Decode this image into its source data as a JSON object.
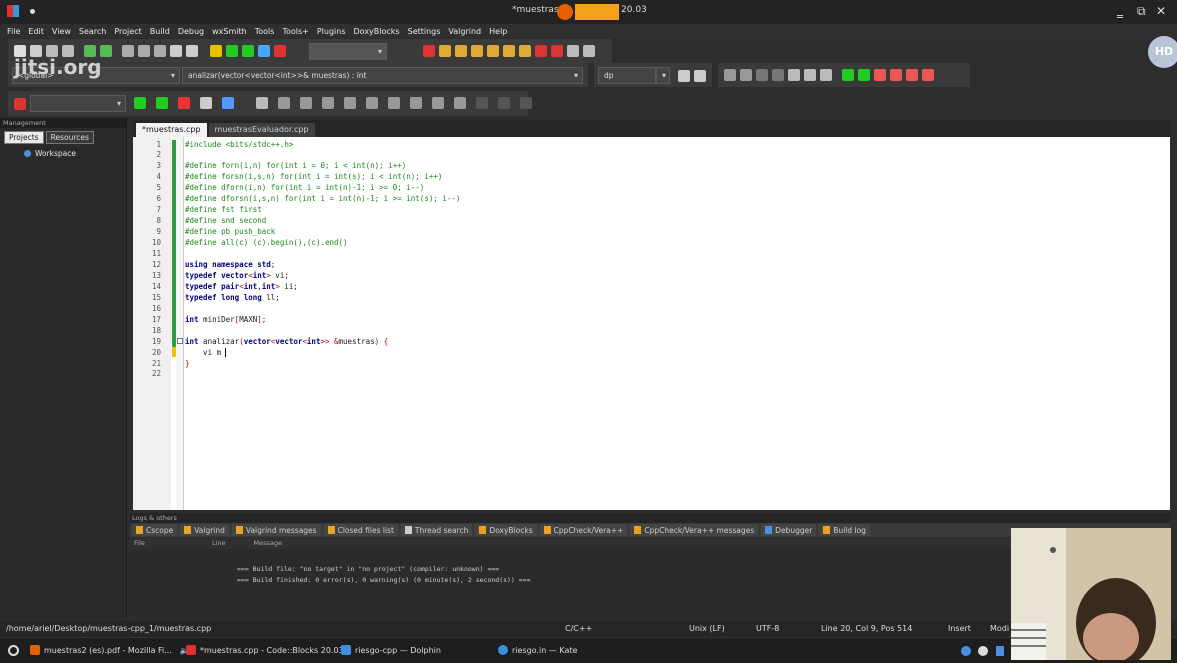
{
  "window": {
    "title_left": "*muestras.c",
    "title_right": "20.03"
  },
  "menu": [
    "File",
    "Edit",
    "View",
    "Search",
    "Project",
    "Build",
    "Debug",
    "wxSmith",
    "Tools",
    "Tools+",
    "Plugins",
    "DoxyBlocks",
    "Settings",
    "Valgrind",
    "Help"
  ],
  "toolbar": {
    "scope_combo": "<global>",
    "function_combo": "analizar(vector<vector<int>>& muestras) : int",
    "search_combo": "dp"
  },
  "overlay": {
    "jitsi_brand": "jitsi.org",
    "hd_badge": "HD"
  },
  "sidebar": {
    "header": "Management",
    "tabs": [
      "Projects",
      "Resources"
    ],
    "active_tab": "Projects",
    "tree_root": "Workspace"
  },
  "editor": {
    "tabs": [
      "*muestras.cpp",
      "muestrasEvaluador.cpp"
    ],
    "active_tab": "*muestras.cpp",
    "lines": [
      {
        "n": "1",
        "segs": [
          [
            "pp",
            "#include <bits/stdc++.h>"
          ]
        ]
      },
      {
        "n": "2",
        "segs": []
      },
      {
        "n": "3",
        "segs": [
          [
            "pp",
            "#define forn(i,n) for(int i = 0; i < int(n); i++)"
          ]
        ]
      },
      {
        "n": "4",
        "segs": [
          [
            "pp",
            "#define forsn(i,s,n) for(int i = int(s); i < int(n); i++)"
          ]
        ]
      },
      {
        "n": "5",
        "segs": [
          [
            "pp",
            "#define dforn(i,n) for(int i = int(n)-1; i >= 0; i--)"
          ]
        ]
      },
      {
        "n": "6",
        "segs": [
          [
            "pp",
            "#define dforsn(i,s,n) for(int i = int(n)-1; i >= int(s); i--)"
          ]
        ]
      },
      {
        "n": "7",
        "segs": [
          [
            "pp",
            "#define fst first"
          ]
        ]
      },
      {
        "n": "8",
        "segs": [
          [
            "pp",
            "#define snd second"
          ]
        ]
      },
      {
        "n": "9",
        "segs": [
          [
            "pp",
            "#define pb push_back"
          ]
        ]
      },
      {
        "n": "10",
        "segs": [
          [
            "pp",
            "#define all(c) (c).begin(),(c).end()"
          ]
        ]
      },
      {
        "n": "11",
        "segs": []
      },
      {
        "n": "12",
        "segs": [
          [
            "kw",
            "using namespace std"
          ],
          [
            "pl",
            ";"
          ]
        ]
      },
      {
        "n": "13",
        "segs": [
          [
            "kw",
            "typedef vector"
          ],
          [
            "op",
            "<"
          ],
          [
            "kw",
            "int"
          ],
          [
            "op",
            ">"
          ],
          [
            "pl",
            " vi;"
          ]
        ]
      },
      {
        "n": "14",
        "segs": [
          [
            "kw",
            "typedef pair"
          ],
          [
            "op",
            "<"
          ],
          [
            "kw",
            "int"
          ],
          [
            "pl",
            ","
          ],
          [
            "kw",
            "int"
          ],
          [
            "op",
            ">"
          ],
          [
            "pl",
            " ii;"
          ]
        ]
      },
      {
        "n": "15",
        "segs": [
          [
            "kw",
            "typedef long long"
          ],
          [
            "pl",
            " ll;"
          ]
        ]
      },
      {
        "n": "16",
        "segs": []
      },
      {
        "n": "17",
        "segs": [
          [
            "kw",
            "int"
          ],
          [
            "pl",
            " miniDer"
          ],
          [
            "op",
            "["
          ],
          [
            "pl",
            "MAXN"
          ],
          [
            "op",
            "]"
          ],
          [
            "pl",
            ";"
          ]
        ]
      },
      {
        "n": "18",
        "segs": []
      },
      {
        "n": "19",
        "segs": [
          [
            "kw",
            "int"
          ],
          [
            "pl",
            " analizar"
          ],
          [
            "op",
            "("
          ],
          [
            "kw",
            "vector"
          ],
          [
            "op",
            "<"
          ],
          [
            "kw",
            "vector"
          ],
          [
            "op",
            "<"
          ],
          [
            "kw",
            "int"
          ],
          [
            "op",
            ">>"
          ],
          [
            "pl",
            " "
          ],
          [
            "op",
            "&"
          ],
          [
            "pl",
            "muestras"
          ],
          [
            "op",
            ")"
          ],
          [
            "pl",
            " "
          ],
          [
            "op",
            "{"
          ]
        ]
      },
      {
        "n": "20",
        "segs": [
          [
            "pl",
            "    vi m"
          ]
        ]
      },
      {
        "n": "21",
        "segs": [
          [
            "op",
            "}"
          ]
        ]
      },
      {
        "n": "22",
        "segs": []
      }
    ]
  },
  "logs": {
    "header": "Logs & others",
    "tabs": [
      "Cscope",
      "Valgrind",
      "Valgrind messages",
      "Closed files list",
      "Thread search",
      "DoxyBlocks",
      "CppCheck/Vera++",
      "CppCheck/Vera++ messages",
      "Debugger",
      "Build log"
    ],
    "columns": [
      "File",
      "Line",
      "Message"
    ],
    "lines": [
      "=== Build file: \"no target\" in \"no project\" (compiler: unknown) ===",
      "=== Build finished: 0 error(s), 0 warning(s) (0 minute(s), 2 second(s)) ==="
    ]
  },
  "status": {
    "path": "/home/ariel/Desktop/muestras-cpp_1/muestras.cpp",
    "lang": "C/C++",
    "eol": "Unix (LF)",
    "encoding": "UTF-8",
    "position": "Line 20, Col 9, Pos 514",
    "mode": "Insert",
    "modified": "Modi"
  },
  "taskbar": [
    {
      "label": "muestras2 (es).pdf - Mozilla Fi...",
      "color": "#e66000"
    },
    {
      "label": "*muestras.cpp - Code::Blocks 20.03",
      "color": "#e03030"
    },
    {
      "label": "riesgo-cpp — Dolphin",
      "color": "#3d8fe0"
    },
    {
      "label": "riesgo.in — Kate",
      "color": "#3d8fe0"
    }
  ],
  "colors": {
    "preprocessor": "#1a8a1a",
    "keyword": "#00008b",
    "operator": "#c80000",
    "changed_line": "#2ea043"
  }
}
